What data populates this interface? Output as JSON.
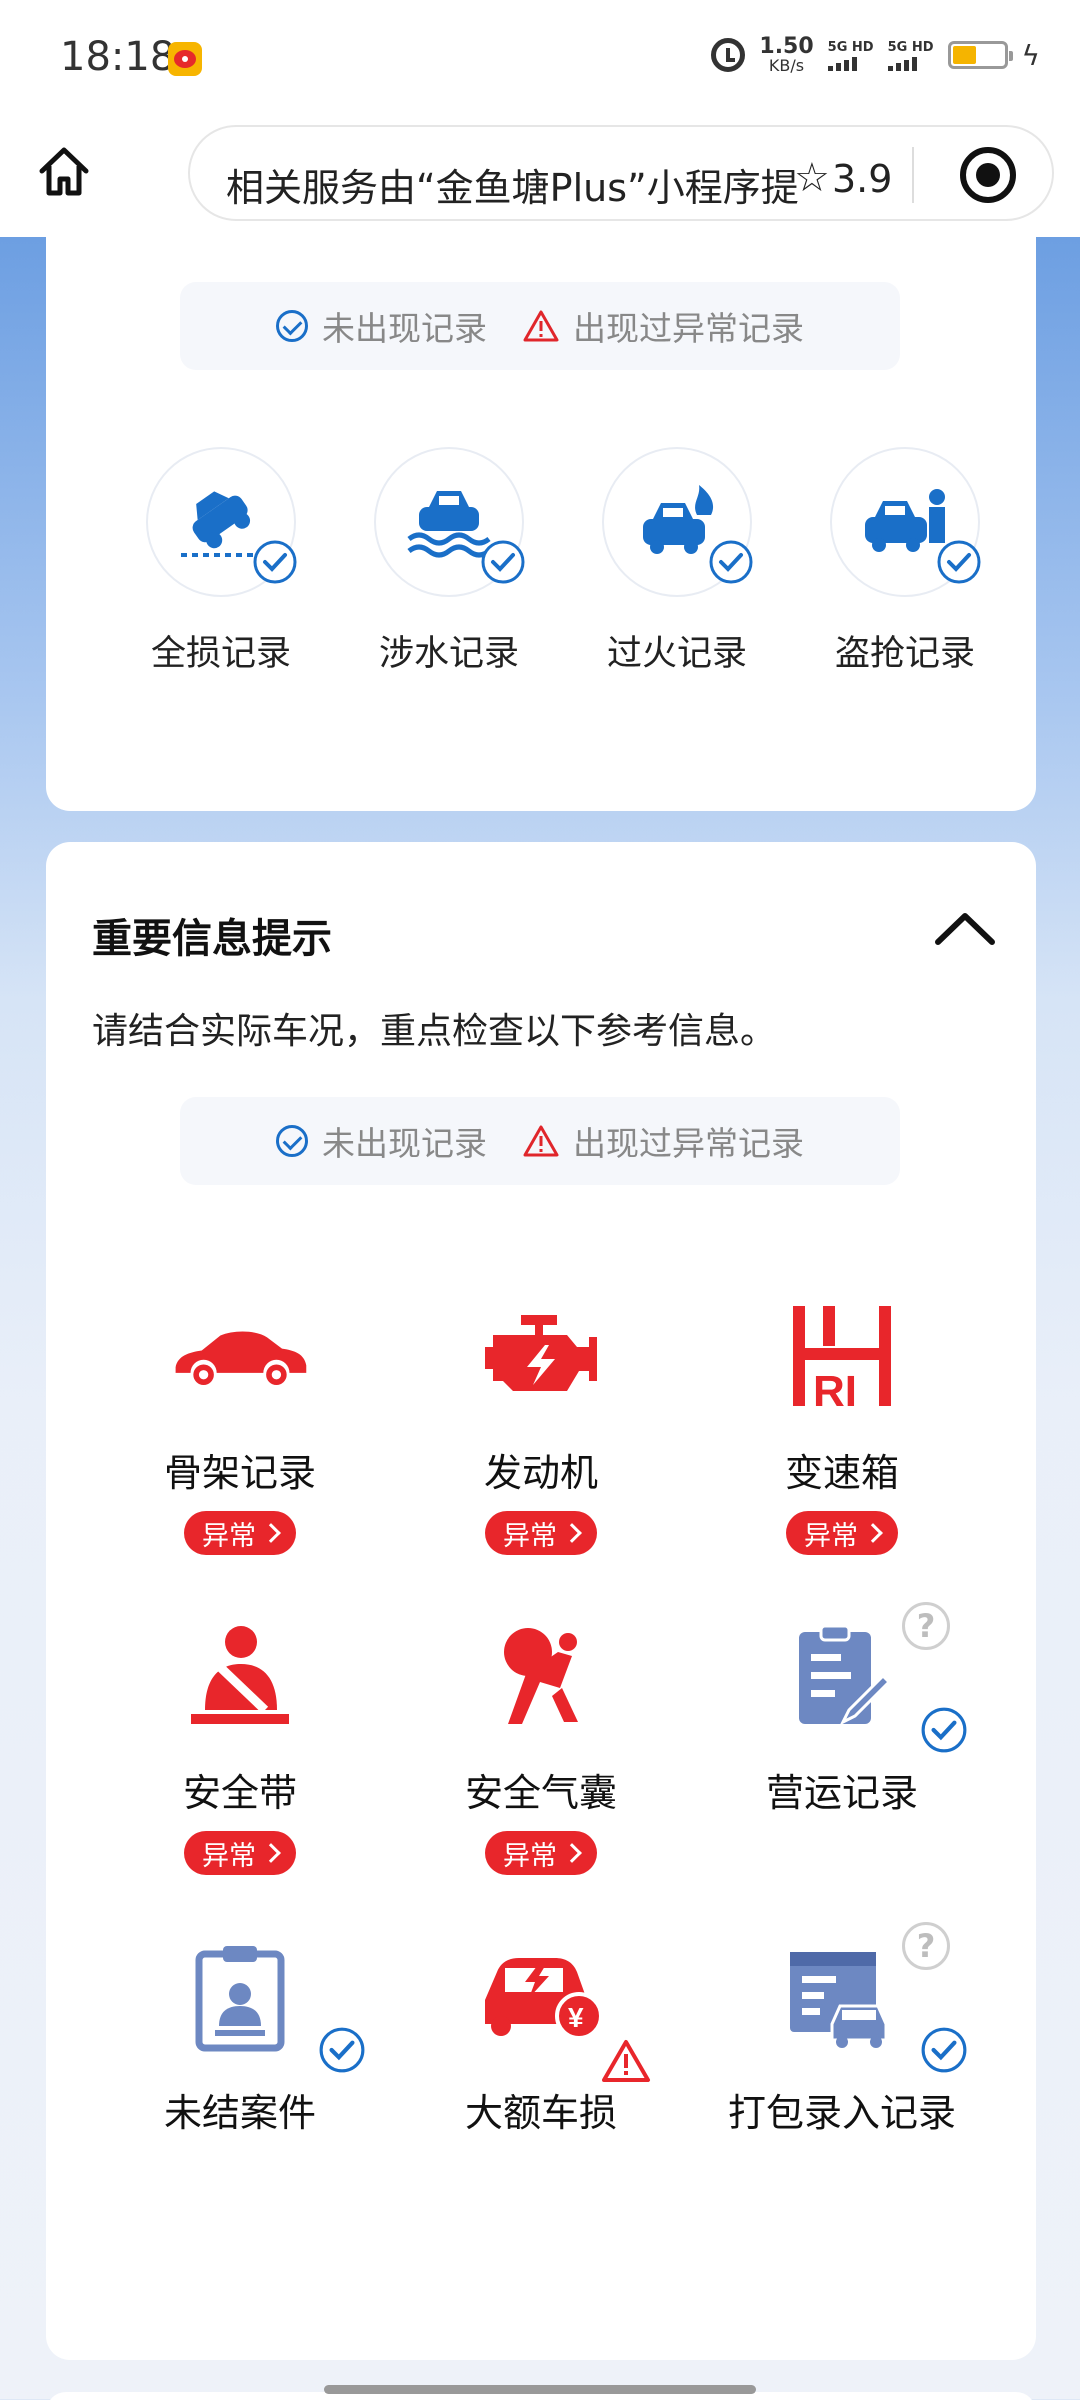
{
  "status_bar": {
    "time": "18:18",
    "net_speed_value": "1.50",
    "net_speed_unit": "KB/s",
    "sim1_label": "5G HD",
    "sim2_label": "5G HD",
    "battery_level": 0.45
  },
  "nav": {
    "url_text": "相关服务由“金鱼塘Plus”小程序提",
    "version": "3.9"
  },
  "record_card": {
    "legend": {
      "ok": "未出现记录",
      "abnormal": "出现过异常记录"
    },
    "items": [
      {
        "label": "全损记录",
        "icon": "total-loss-icon",
        "status": "ok"
      },
      {
        "label": "涉水记录",
        "icon": "flood-icon",
        "status": "ok"
      },
      {
        "label": "过火记录",
        "icon": "fire-icon",
        "status": "ok"
      },
      {
        "label": "盗抢记录",
        "icon": "theft-icon",
        "status": "ok"
      }
    ]
  },
  "important": {
    "title": "重要信息提示",
    "subtitle": "请结合实际车况，重点检查以下参考信息。",
    "legend": {
      "ok": "未出现记录",
      "abnormal": "出现过异常记录"
    },
    "abnormal_tag": "异常",
    "items": [
      {
        "label": "骨架记录",
        "icon": "car-frame-icon",
        "status": "abnormal"
      },
      {
        "label": "发动机",
        "icon": "engine-icon",
        "status": "abnormal"
      },
      {
        "label": "变速箱",
        "icon": "gearbox-icon",
        "status": "abnormal"
      },
      {
        "label": "安全带",
        "icon": "seatbelt-icon",
        "status": "abnormal"
      },
      {
        "label": "安全气囊",
        "icon": "airbag-icon",
        "status": "abnormal"
      },
      {
        "label": "营运记录",
        "icon": "clipboard-icon",
        "status": "ok",
        "help": "?"
      },
      {
        "label": "未结案件",
        "icon": "case-file-icon",
        "status": "ok"
      },
      {
        "label": "大额车损",
        "icon": "car-damage-icon",
        "status": "warn"
      },
      {
        "label": "打包录入记录",
        "icon": "package-record-icon",
        "status": "ok",
        "help": "?"
      }
    ]
  },
  "colors": {
    "accent_blue": "#1a6fc8",
    "alert_red": "#e8262b",
    "icon_slate": "#6d88c2"
  }
}
